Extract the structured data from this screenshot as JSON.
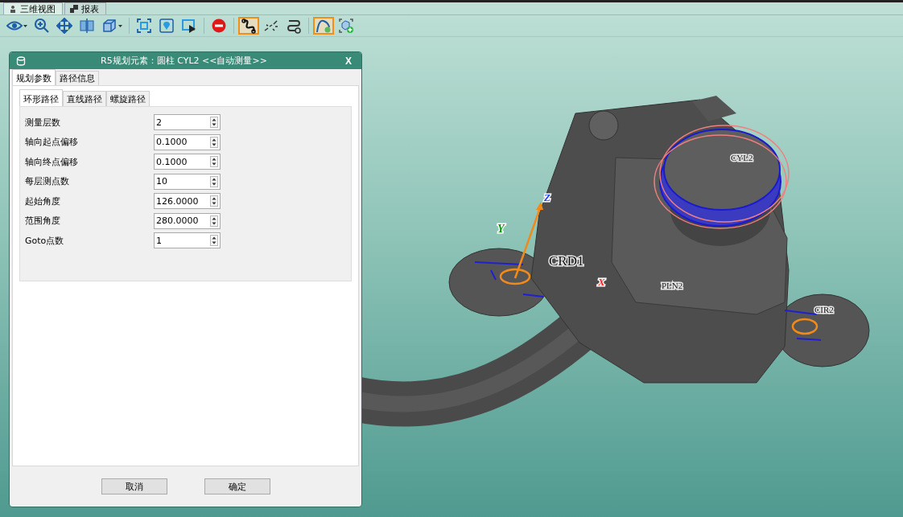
{
  "view_tabs": [
    {
      "label": "三维视图",
      "selected": true
    },
    {
      "label": "报表",
      "selected": false
    }
  ],
  "toolbar": [
    {
      "kind": "eye",
      "selected": false
    },
    {
      "kind": "zoom",
      "selected": false
    },
    {
      "kind": "move",
      "selected": false
    },
    {
      "kind": "section",
      "selected": false
    },
    {
      "kind": "cube",
      "selected": false
    },
    {
      "kind": "sep"
    },
    {
      "kind": "fit",
      "selected": false
    },
    {
      "kind": "pin",
      "selected": false
    },
    {
      "kind": "screen",
      "selected": false
    },
    {
      "kind": "sep"
    },
    {
      "kind": "stop",
      "selected": false
    },
    {
      "kind": "sep"
    },
    {
      "kind": "path",
      "selected": true
    },
    {
      "kind": "scatter",
      "selected": false
    },
    {
      "kind": "pathgear",
      "selected": false
    },
    {
      "kind": "sep"
    },
    {
      "kind": "curve",
      "selected": true
    },
    {
      "kind": "cubeadd",
      "selected": false
    }
  ],
  "viewport_labels": [
    {
      "text": "CYL2",
      "kind": "feature"
    },
    {
      "text": "CRD1",
      "kind": "frame"
    },
    {
      "text": "PLN2",
      "kind": "feature"
    },
    {
      "text": "CIR2",
      "kind": "feature"
    },
    {
      "text": "X",
      "kind": "axis",
      "color": "#ff2020"
    },
    {
      "text": "Y",
      "kind": "axis",
      "color": "#00a000"
    },
    {
      "text": "Z",
      "kind": "axis",
      "color": "#2040ff"
    }
  ],
  "dialog": {
    "title": "R5规划元素：圆柱 CYL2 <<自动测量>>",
    "close": "X",
    "tabs": [
      {
        "label": "规划参数",
        "selected": true
      },
      {
        "label": "路径信息",
        "selected": false
      }
    ],
    "sub_tabs": [
      {
        "label": "环形路径",
        "selected": true
      },
      {
        "label": "直线路径",
        "selected": false
      },
      {
        "label": "螺旋路径",
        "selected": false
      }
    ],
    "fields": [
      {
        "label": "测量层数",
        "value": "2"
      },
      {
        "label": "轴向起点偏移",
        "value": "0.1000"
      },
      {
        "label": "轴向终点偏移",
        "value": "0.1000"
      },
      {
        "label": "每层测点数",
        "value": "10"
      },
      {
        "label": "起始角度",
        "value": "126.0000"
      },
      {
        "label": "范围角度",
        "value": "280.0000"
      },
      {
        "label": "Goto点数",
        "value": "1"
      }
    ],
    "buttons": [
      "取消",
      "确定"
    ]
  }
}
